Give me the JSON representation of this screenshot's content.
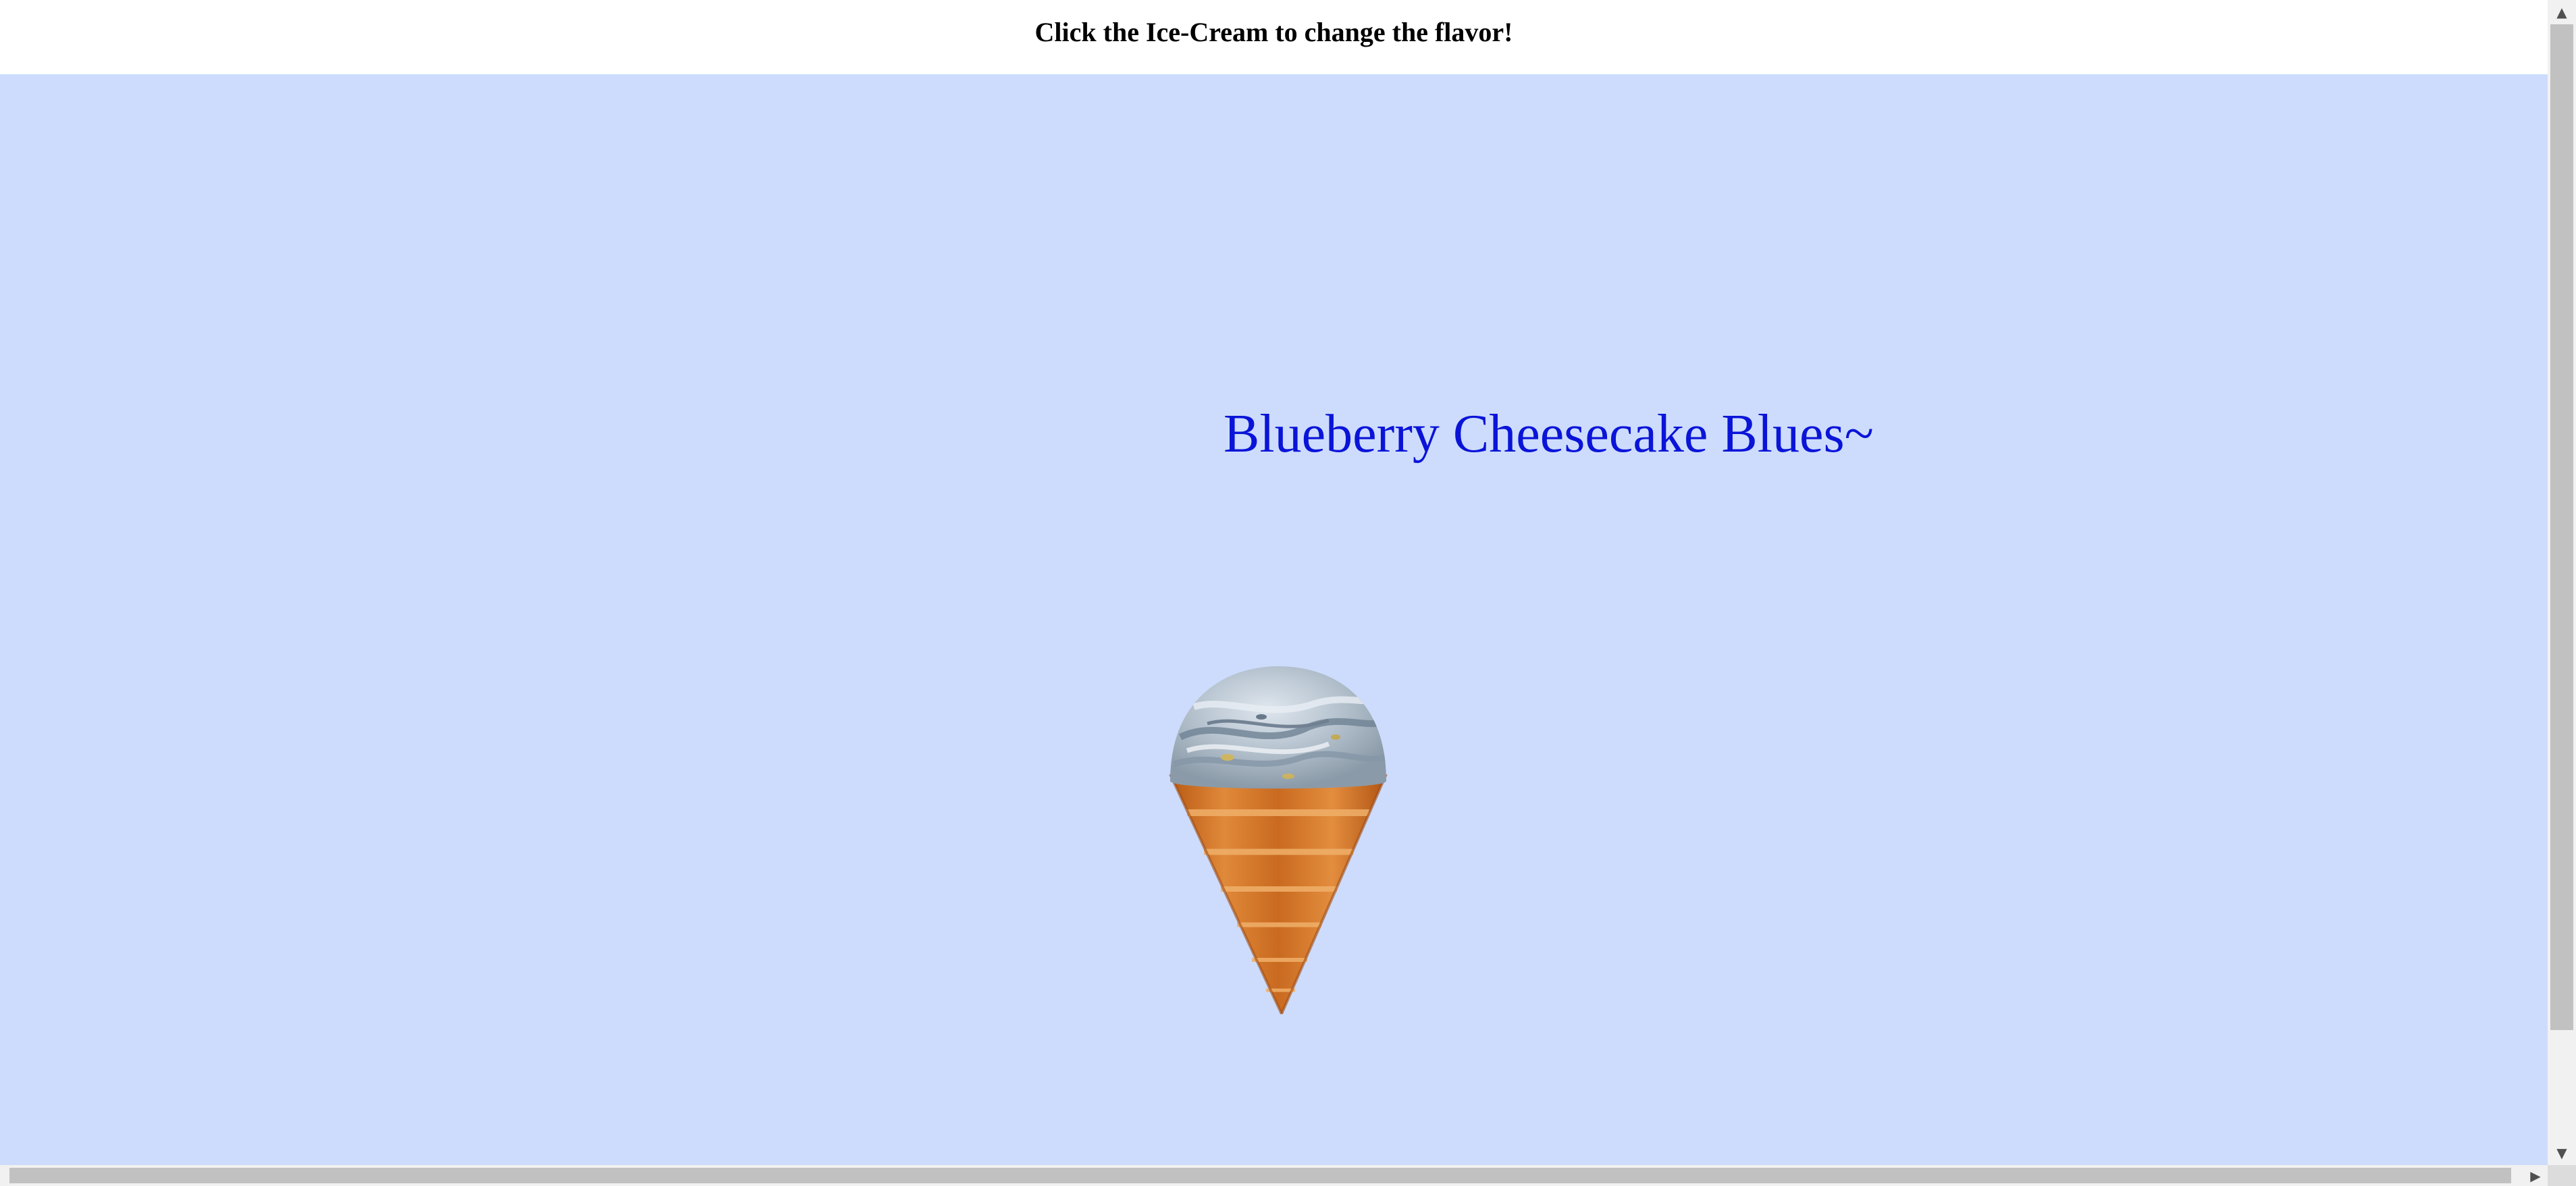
{
  "header": {
    "instruction": "Click the Ice-Cream to change the flavor!"
  },
  "stage": {
    "background_color": "#cddcfc"
  },
  "flavor": {
    "name": "Blueberry Cheesecake Blues~",
    "color": "#0a14d8"
  },
  "icecream": {
    "scoop_icon": "blueberry-scoop",
    "cone_icon": "waffle-cone"
  },
  "scrollbars": {
    "up_arrow": "▲",
    "down_arrow": "▼",
    "right_arrow": "▶"
  }
}
